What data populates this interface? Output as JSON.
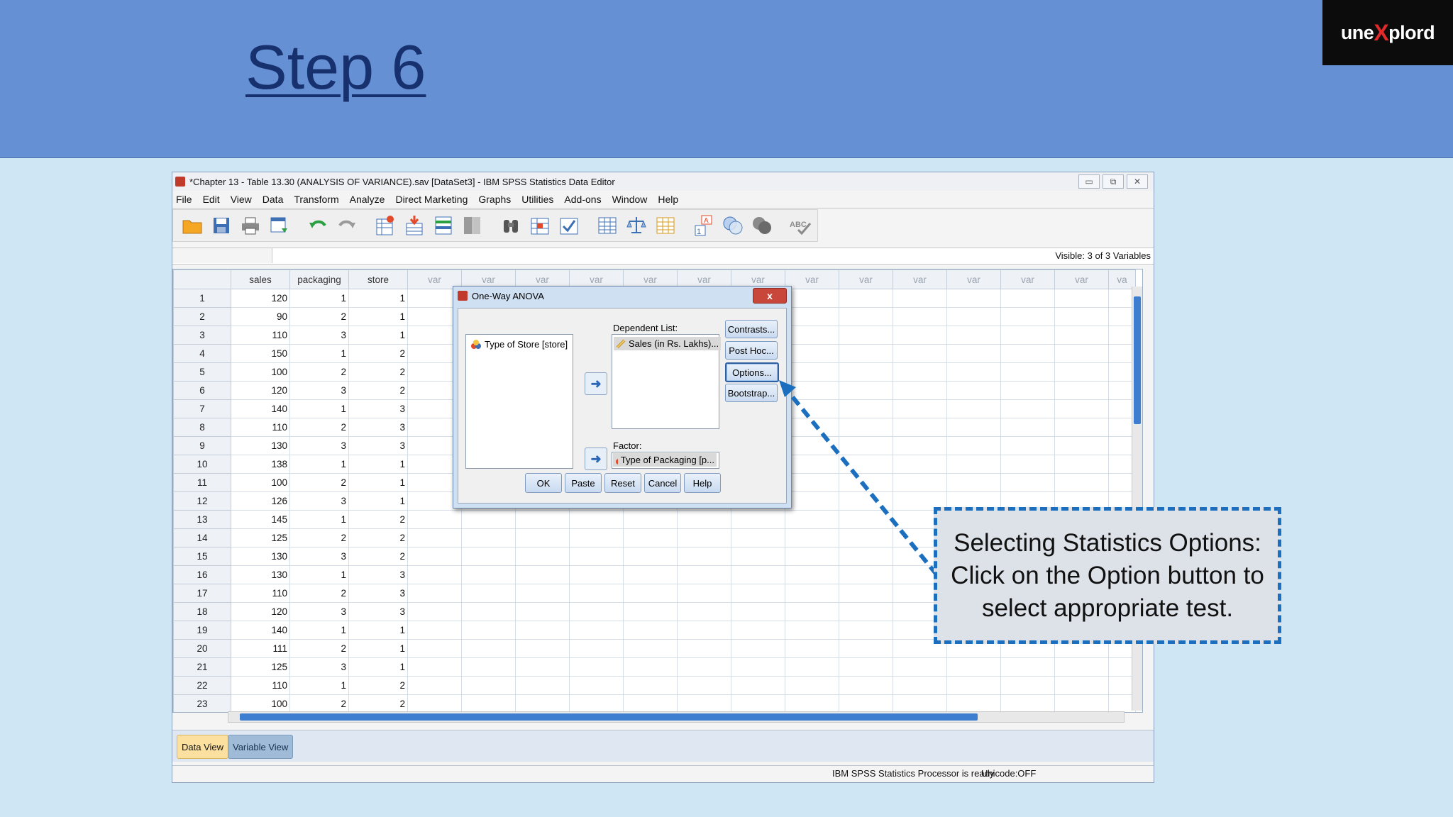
{
  "slide": {
    "title": "Step 6",
    "logo_left": "une",
    "logo_x": "X",
    "logo_right": "plord"
  },
  "window": {
    "title": "*Chapter 13 - Table 13.30 (ANALYSIS OF VARIANCE).sav [DataSet3] - IBM SPSS Statistics Data Editor",
    "controls": [
      "▭",
      "⧉",
      "✕"
    ]
  },
  "menu": [
    "File",
    "Edit",
    "View",
    "Data",
    "Transform",
    "Analyze",
    "Direct Marketing",
    "Graphs",
    "Utilities",
    "Add-ons",
    "Window",
    "Help"
  ],
  "toolbar_icons": [
    "open-folder-icon",
    "save-icon",
    "print-icon",
    "recall-dialog-icon",
    "undo-icon",
    "redo-icon",
    "goto-case-icon",
    "goto-variable-icon",
    "variables-icon",
    "find-icon",
    "insert-cases-icon",
    "insert-variable-icon",
    "split-file-icon",
    "weight-cases-icon",
    "select-cases-icon",
    "value-labels-icon",
    "use-sets-icon",
    "show-all-variables-icon",
    "spell-check-icon"
  ],
  "visible_vars": "Visible: 3 of 3 Variables",
  "grid": {
    "columns": [
      "sales",
      "packaging",
      "store",
      "var",
      "var",
      "var",
      "var",
      "var",
      "var",
      "var",
      "var",
      "var",
      "var",
      "var",
      "var",
      "var",
      "va"
    ],
    "rows": [
      [
        "1",
        "120",
        "1",
        "1"
      ],
      [
        "2",
        "90",
        "2",
        "1"
      ],
      [
        "3",
        "110",
        "3",
        "1"
      ],
      [
        "4",
        "150",
        "1",
        "2"
      ],
      [
        "5",
        "100",
        "2",
        "2"
      ],
      [
        "6",
        "120",
        "3",
        "2"
      ],
      [
        "7",
        "140",
        "1",
        "3"
      ],
      [
        "8",
        "110",
        "2",
        "3"
      ],
      [
        "9",
        "130",
        "3",
        "3"
      ],
      [
        "10",
        "138",
        "1",
        "1"
      ],
      [
        "11",
        "100",
        "2",
        "1"
      ],
      [
        "12",
        "126",
        "3",
        "1"
      ],
      [
        "13",
        "145",
        "1",
        "2"
      ],
      [
        "14",
        "125",
        "2",
        "2"
      ],
      [
        "15",
        "130",
        "3",
        "2"
      ],
      [
        "16",
        "130",
        "1",
        "3"
      ],
      [
        "17",
        "110",
        "2",
        "3"
      ],
      [
        "18",
        "120",
        "3",
        "3"
      ],
      [
        "19",
        "140",
        "1",
        "1"
      ],
      [
        "20",
        "111",
        "2",
        "1"
      ],
      [
        "21",
        "125",
        "3",
        "1"
      ],
      [
        "22",
        "110",
        "1",
        "2"
      ],
      [
        "23",
        "100",
        "2",
        "2"
      ]
    ]
  },
  "tabs": {
    "data_view": "Data View",
    "variable_view": "Variable View"
  },
  "status": {
    "processor": "IBM SPSS Statistics Processor is ready",
    "unicode": "Unicode:OFF"
  },
  "dialog": {
    "title": "One-Way ANOVA",
    "close": "x",
    "source_item": "Type of Store [store]",
    "dependent_label": "Dependent List:",
    "dependent_item": "Sales (in Rs. Lakhs)...",
    "factor_label": "Factor:",
    "factor_item": "Type of Packaging [p...",
    "side_buttons": [
      "Contrasts...",
      "Post Hoc...",
      "Options...",
      "Bootstrap..."
    ],
    "bottom_buttons": [
      "OK",
      "Paste",
      "Reset",
      "Cancel",
      "Help"
    ]
  },
  "callout": {
    "line1": "Selecting Statistics Options:",
    "line2": "Click on the Option button to",
    "line3": "select appropriate test."
  },
  "colors": {
    "header_bg": "#6690d4",
    "title": "#17306e",
    "callout_border": "#1c6fbe",
    "page_bg": "#cfe6f5"
  }
}
